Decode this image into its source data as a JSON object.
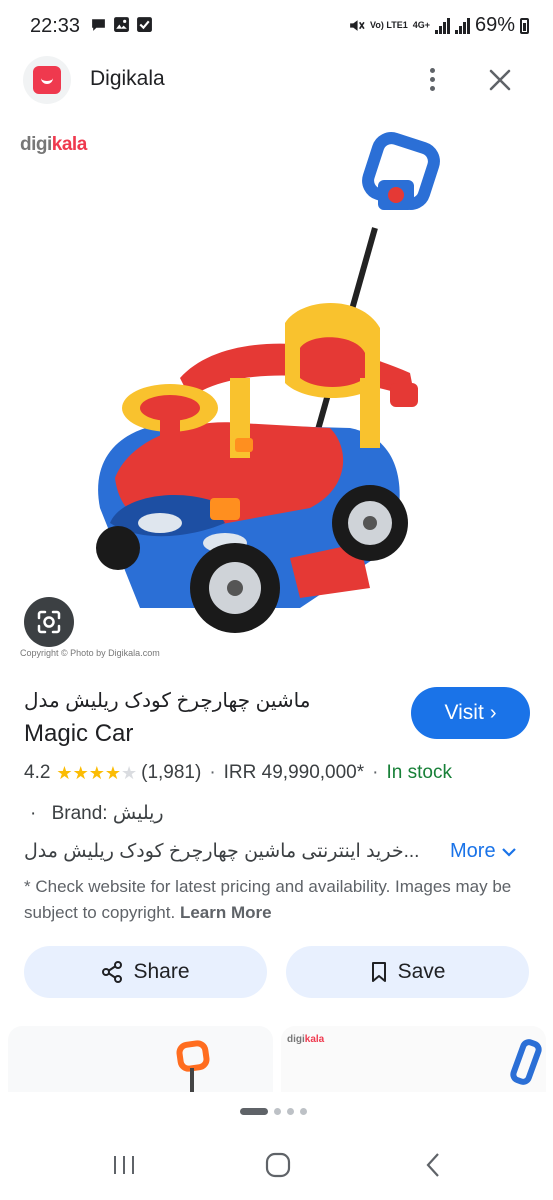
{
  "status_bar": {
    "time": "22:33",
    "network_label": "Vo) LTE1",
    "network_type": "4G+",
    "battery": "69%",
    "icons": [
      "chat-icon",
      "image-icon",
      "check-icon",
      "mute-icon",
      "signal-icon",
      "battery-icon"
    ]
  },
  "app_header": {
    "title": "Digikala",
    "icons": [
      "digikala-logo",
      "more-vert-icon",
      "close-icon"
    ]
  },
  "image": {
    "watermark_prefix": "digi",
    "watermark_suffix": "kala",
    "copyright": "Copyright © Photo by Digikala.com",
    "lens_icon": "google-lens-icon"
  },
  "product": {
    "title_fa": "ماشین چهارچرخ کودک ریلیش مدل",
    "title_en": "Magic Car",
    "visit_label": "Visit",
    "rating": "4.2",
    "rating_value": 4.2,
    "rating_max": 5,
    "reviews": "(1,981)",
    "price": "IRR 49,990,000*",
    "availability": "In stock",
    "brand_label": "Brand:",
    "brand_value": "ریلیش",
    "description": "...خرید اینترنتی ماشین چهارچرخ کودک ریلیش مدل",
    "more_label": "More",
    "disclaimer": "* Check website for latest pricing and availability. Images may be subject to copyright.",
    "learn_more": "Learn More",
    "share_label": "Share",
    "save_label": "Save"
  },
  "related": {
    "card2_watermark_prefix": "digi",
    "card2_watermark_suffix": "kala"
  },
  "pager": {
    "current": 1,
    "total": 4
  },
  "colors": {
    "accent": "#1a73e8",
    "in_stock": "#188038",
    "star": "#fbbc04",
    "brand": "#ef394e",
    "button_bg": "#e8f0fe"
  }
}
